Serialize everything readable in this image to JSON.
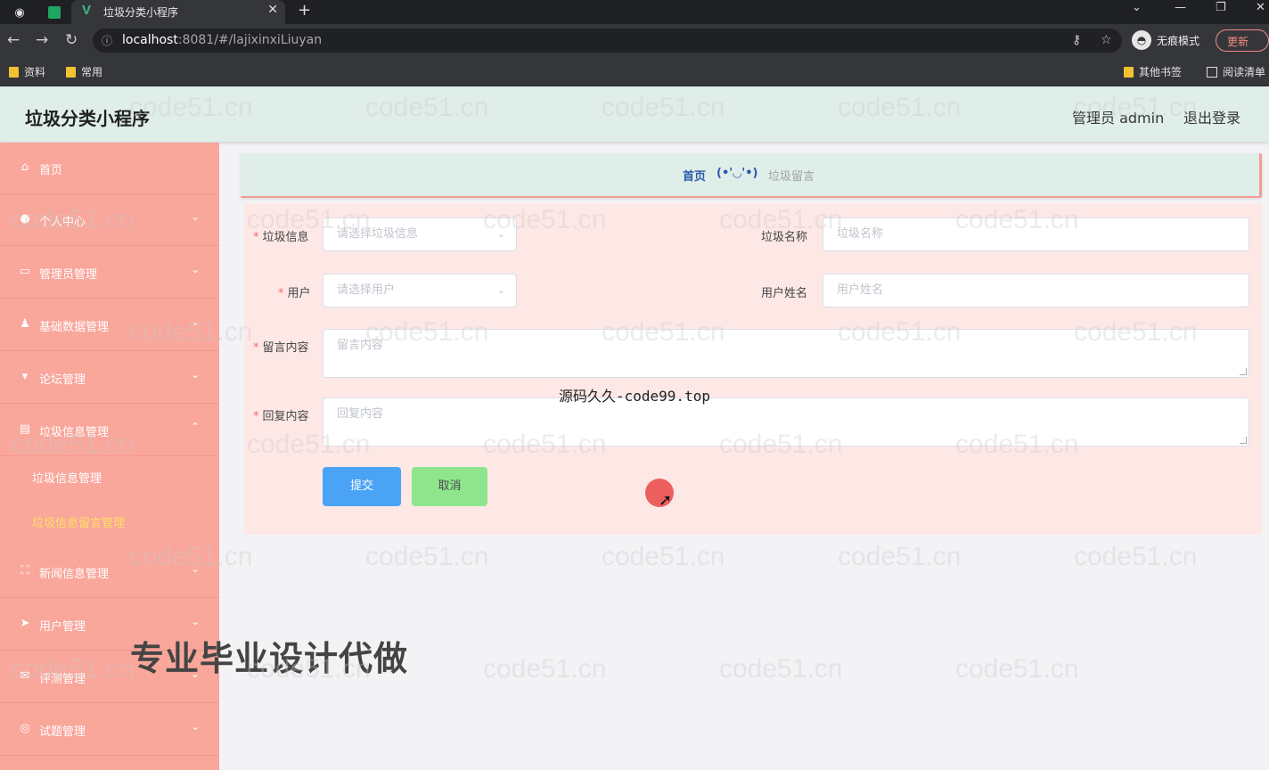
{
  "browser": {
    "tab_title": "垃圾分类小程序",
    "tab_close": "✕",
    "new_tab": "+",
    "url_host": "localhost",
    "url_rest": ":8081/#/lajixinxiLiuyan",
    "incognito_label": "无痕模式",
    "update_label": "更新",
    "bookmarks": [
      "资料",
      "常用"
    ],
    "other_bookmarks": "其他书签",
    "reading_list": "阅读清单"
  },
  "header": {
    "title": "垃圾分类小程序",
    "admin": "管理员 admin",
    "logout": "退出登录"
  },
  "sidebar": {
    "items": [
      {
        "label": "首页",
        "icon": "home-icon"
      },
      {
        "label": "个人中心",
        "icon": "user-icon"
      },
      {
        "label": "管理员管理",
        "icon": "id-card-icon"
      },
      {
        "label": "基础数据管理",
        "icon": "user-group-icon"
      },
      {
        "label": "论坛管理",
        "icon": "podium-icon"
      },
      {
        "label": "垃圾信息管理",
        "icon": "clipboard-icon"
      },
      {
        "label": "新闻信息管理",
        "icon": "expand-icon"
      },
      {
        "label": "用户管理",
        "icon": "send-icon"
      },
      {
        "label": "评测管理",
        "icon": "mail-icon"
      },
      {
        "label": "试题管理",
        "icon": "target-icon"
      }
    ],
    "subitems": [
      {
        "label": "垃圾信息管理"
      },
      {
        "label": "垃圾信息留言管理"
      }
    ]
  },
  "breadcrumb": {
    "home": "首页",
    "separator": "(•'◡'•)",
    "current": "垃圾留言"
  },
  "form": {
    "lajixinxi_label": "垃圾信息",
    "lajixinxi_placeholder": "请选择垃圾信息",
    "laji_name_label": "垃圾名称",
    "laji_name_placeholder": "垃圾名称",
    "user_label": "用户",
    "user_placeholder": "请选择用户",
    "user_name_label": "用户姓名",
    "user_name_placeholder": "用户姓名",
    "message_label": "留言内容",
    "message_placeholder": "留言内容",
    "reply_label": "回复内容",
    "reply_placeholder": "回复内容",
    "submit": "提交",
    "cancel": "取消"
  },
  "overlay": {
    "source_text": "源码久久-code99.top",
    "promo_text": "专业毕业设计代做",
    "watermark": "code51.cn"
  },
  "colors": {
    "sidebar": "#f9a69b",
    "header": "#dfeee9",
    "submit": "#4aa3f5",
    "cancel": "#8fe58b",
    "active_sub": "#ffe066"
  }
}
